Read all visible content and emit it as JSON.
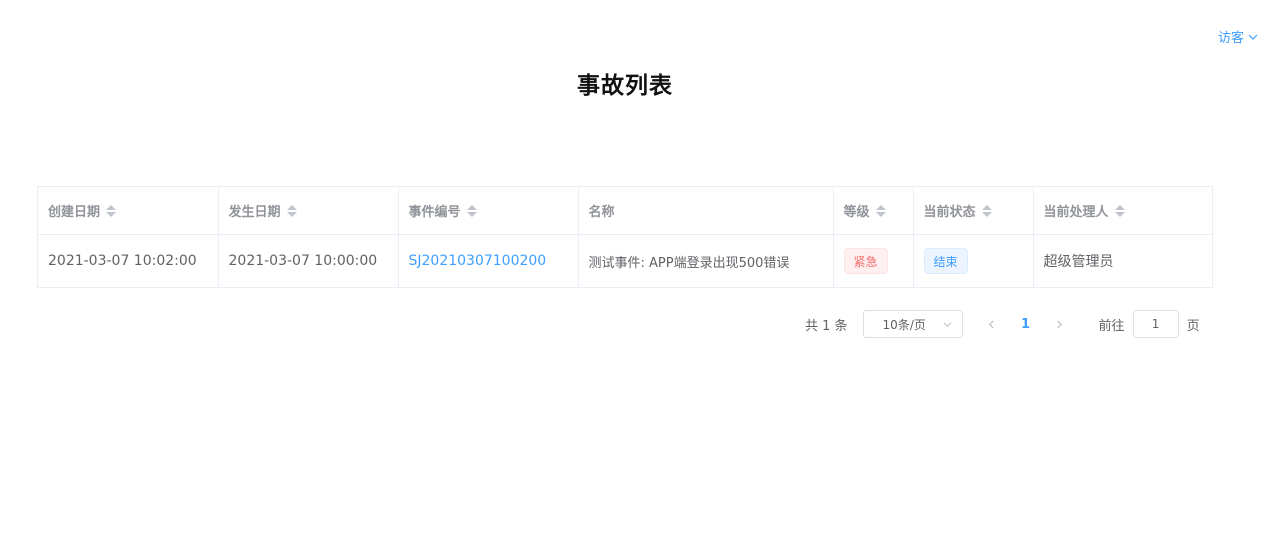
{
  "header": {
    "user_label": "访客"
  },
  "page": {
    "title": "事故列表"
  },
  "table": {
    "columns": [
      {
        "label": "创建日期",
        "sortable": true
      },
      {
        "label": "发生日期",
        "sortable": true
      },
      {
        "label": "事件编号",
        "sortable": true
      },
      {
        "label": "名称",
        "sortable": false
      },
      {
        "label": "等级",
        "sortable": true
      },
      {
        "label": "当前状态",
        "sortable": true
      },
      {
        "label": "当前处理人",
        "sortable": true
      }
    ],
    "rows": [
      {
        "created": "2021-03-07 10:02:00",
        "occurred": "2021-03-07 10:00:00",
        "event_id": "SJ20210307100200",
        "name": "测试事件: APP端登录出现500错误",
        "level": "紧急",
        "status": "结束",
        "handler": "超级管理员"
      }
    ]
  },
  "pagination": {
    "total_text": "共 1 条",
    "page_size": "10条/页",
    "current_page": "1",
    "jump_label": "前往",
    "jump_value": "1",
    "page_unit": "页"
  },
  "colors": {
    "accent": "#409EFF",
    "danger": "#F56C6C",
    "border": "#EBEEF5"
  }
}
